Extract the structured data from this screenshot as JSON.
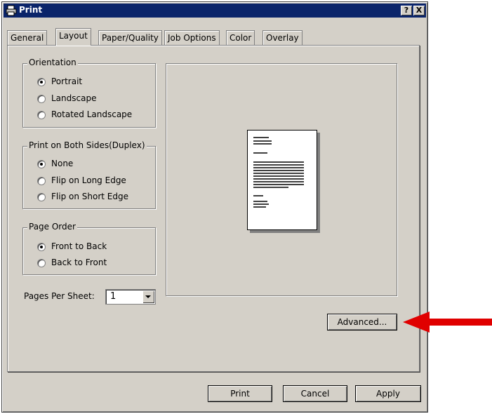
{
  "window": {
    "title": "Print",
    "help_btn": "?",
    "close_btn": "X"
  },
  "tabs": [
    {
      "label": "General"
    },
    {
      "label": "Layout"
    },
    {
      "label": "Paper/Quality"
    },
    {
      "label": "Job Options"
    },
    {
      "label": "Color"
    },
    {
      "label": "Overlay"
    }
  ],
  "orientation": {
    "title": "Orientation",
    "options": [
      "Portrait",
      "Landscape",
      "Rotated Landscape"
    ],
    "selected": "Portrait"
  },
  "duplex": {
    "title": "Print on Both Sides(Duplex)",
    "options": [
      "None",
      "Flip on Long Edge",
      "Flip on Short Edge"
    ],
    "selected": "None"
  },
  "page_order": {
    "title": "Page Order",
    "options": [
      "Front to Back",
      "Back to Front"
    ],
    "selected": "Front to Back"
  },
  "pages_per_sheet": {
    "label": "Pages Per Sheet:",
    "value": "1"
  },
  "buttons": {
    "advanced": "Advanced...",
    "print": "Print",
    "cancel": "Cancel",
    "apply": "Apply"
  },
  "colors": {
    "titlebar": "#0a246a",
    "dialog_bg": "#d4d0c8",
    "annotation_arrow": "#e00000"
  },
  "icons": {
    "app": "printer-icon",
    "annotation": "red-arrow-icon"
  }
}
